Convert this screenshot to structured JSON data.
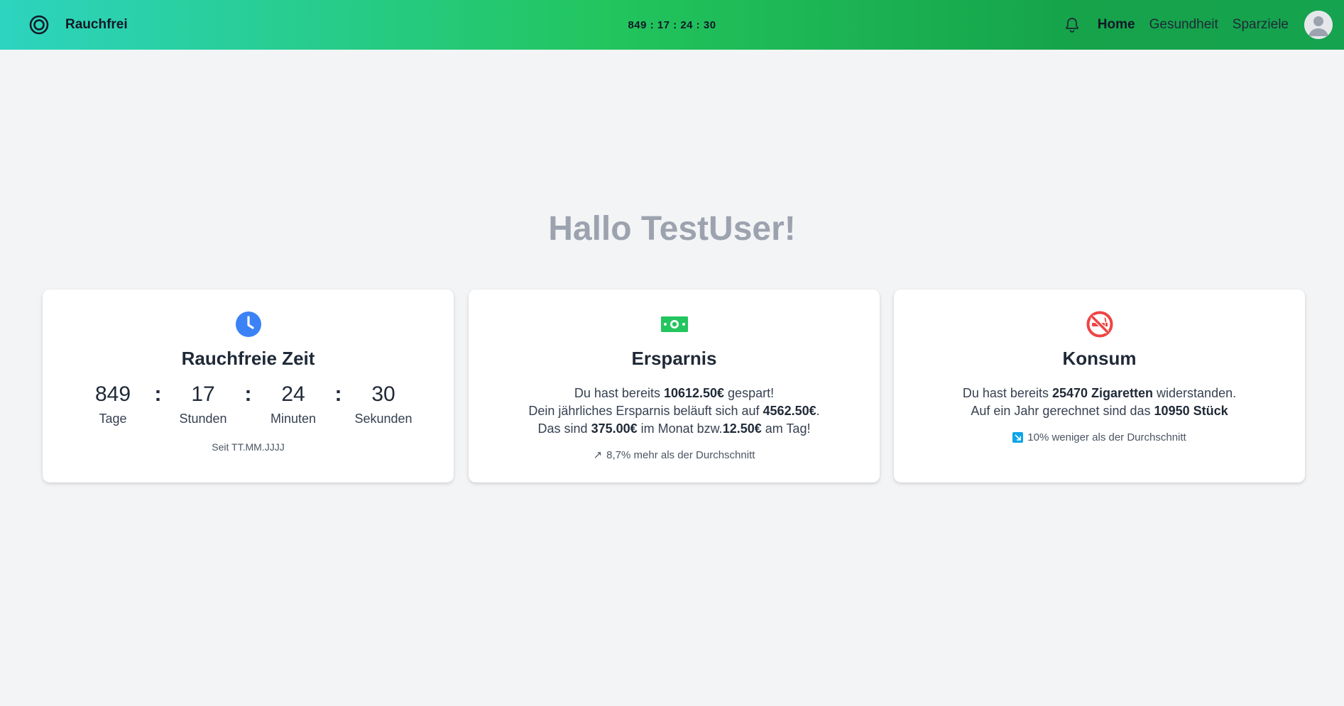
{
  "header": {
    "brand": "Rauchfrei",
    "timer": "849 : 17 : 24 : 30",
    "nav": {
      "home": "Home",
      "gesundheit": "Gesundheit",
      "sparziele": "Sparziele"
    },
    "icons": {
      "brand": "target-icon",
      "notifications": "bell-icon",
      "profile": "avatar-icon"
    }
  },
  "greeting": "Hallo TestUser!",
  "cards": {
    "time": {
      "icon": "clock-icon",
      "title": "Rauchfreie Zeit",
      "days": "849",
      "days_label": "Tage",
      "hours": "17",
      "hours_label": "Stunden",
      "minutes": "24",
      "minutes_label": "Minuten",
      "seconds": "30",
      "seconds_label": "Sekunden",
      "separator": ":",
      "since": "Seit TT.MM.JJJJ"
    },
    "savings": {
      "icon": "money-icon",
      "title": "Ersparnis",
      "line1_pre": "Du hast bereits ",
      "line1_value": "10612.50€",
      "line1_post": " gespart!",
      "line2_pre": "Dein jährliches Ersparnis beläuft sich auf ",
      "line2_value": "4562.50€",
      "line2_post": ".",
      "line3_pre": "Das sind ",
      "line3_value1": "375.00€",
      "line3_mid": " im Monat bzw.",
      "line3_value2": "12.50€",
      "line3_post": " am Tag!",
      "note_icon": "↗",
      "note": "8,7% mehr als der Durchschnitt"
    },
    "consumption": {
      "icon": "no-smoking-icon",
      "title": "Konsum",
      "line1_pre": "Du hast bereits ",
      "line1_value": "25470 Zigaretten",
      "line1_post": " widerstanden.",
      "line2_pre": "Auf ein Jahr gerechnet sind das ",
      "line2_value": "10950 Stück",
      "note_icon": "trend-down-icon",
      "note": "10% weniger als der Durchschnitt"
    }
  },
  "colors": {
    "header_gradient_start": "#2dd4bf",
    "header_gradient_end": "#16a34a",
    "clock": "#3b82f6",
    "money": "#22c55e",
    "no_smoking": "#ef4444",
    "trend_down": "#0ea5e9"
  }
}
